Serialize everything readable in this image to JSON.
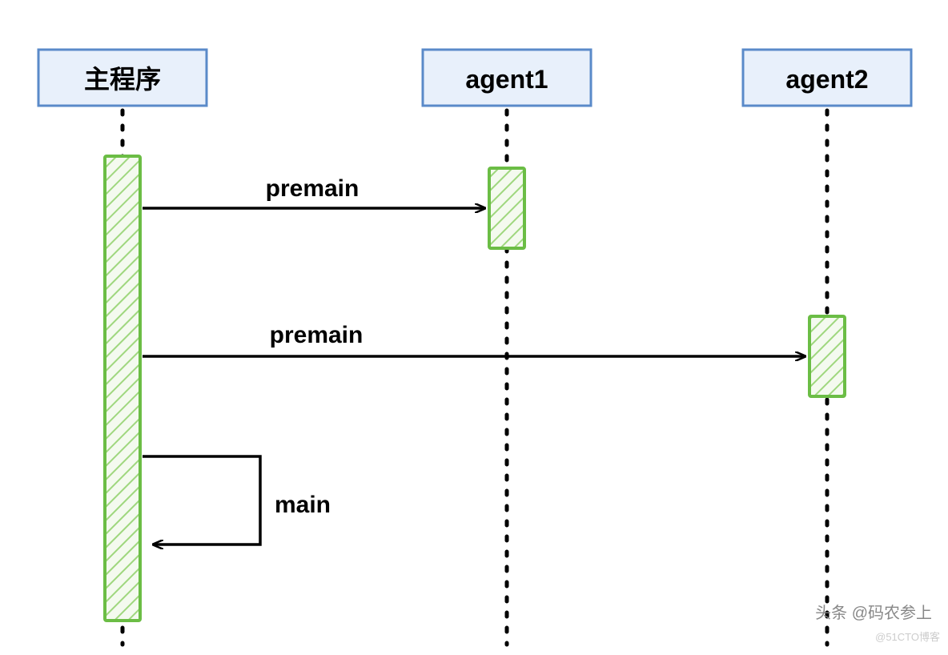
{
  "lifelines": {
    "main": {
      "label": "主程序"
    },
    "agent1": {
      "label": "agent1"
    },
    "agent2": {
      "label": "agent2"
    }
  },
  "messages": {
    "call1": {
      "label": "premain"
    },
    "call2": {
      "label": "premain"
    },
    "selfcall": {
      "label": "main"
    }
  },
  "watermark": {
    "author": "头条 @码农参上",
    "source": "@51CTO博客"
  },
  "colors": {
    "headerFill": "#e8f0fb",
    "headerStroke": "#5a8ac9",
    "activationStroke": "#6bbd45",
    "activationFill": "#d9edc9",
    "line": "#000000"
  }
}
